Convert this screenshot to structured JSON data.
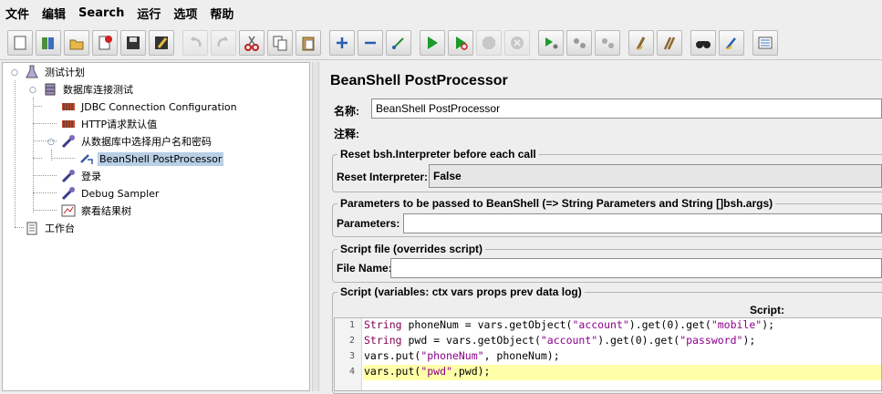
{
  "menu": {
    "items": [
      "文件",
      "编辑",
      "Search",
      "运行",
      "选项",
      "帮助"
    ]
  },
  "toolbar": {
    "buttons": [
      "new-icon",
      "templates-icon",
      "open-icon",
      "close-icon",
      "save-icon",
      "save-as-icon",
      "undo-icon",
      "redo-icon",
      "cut-icon",
      "copy-icon",
      "paste-icon",
      "expand-icon",
      "collapse-icon",
      "toggle-icon",
      "start-icon",
      "start-no-pause-icon",
      "stop-icon",
      "shutdown-icon",
      "remote-start-icon",
      "remote-stop-icon",
      "remote-shutdown-icon",
      "clear-icon",
      "clear-all-icon",
      "search-icon",
      "reset-search-icon",
      "function-helper-icon"
    ]
  },
  "tree": {
    "test_plan": "测试计划",
    "thread_group": "数据库连接测试",
    "jdbc_config": "JDBC Connection Configuration",
    "http_defaults": "HTTP请求默认值",
    "jdbc_sampler": "从数据库中选择用户名和密码",
    "beanshell": "BeanShell PostProcessor",
    "login": "登录",
    "debug_sampler": "Debug Sampler",
    "results_tree": "察看结果树",
    "workbench": "工作台"
  },
  "panel": {
    "title": "BeanShell PostProcessor",
    "name_label": "名称:",
    "name_value": "BeanShell PostProcessor",
    "comments_label": "注释:",
    "comments_value": "",
    "reset_group_title": "Reset bsh.Interpreter before each call",
    "reset_label": "Reset Interpreter:",
    "reset_value": "False",
    "params_group_title": "Parameters to be passed to BeanShell (=> String Parameters and String []bsh.args)",
    "params_label": "Parameters:",
    "params_value": "",
    "file_group_title": "Script file (overrides script)",
    "file_label": "File Name:",
    "file_value": "",
    "script_group_title": "Script (variables: ctx vars props prev data log)",
    "script_label": "Script:"
  },
  "script": {
    "line_numbers": [
      "1",
      "2",
      "3",
      "4"
    ],
    "lines": [
      "String phoneNum = vars.getObject(\"account\").get(0).get(\"mobile\");",
      "String pwd = vars.getObject(\"account\").get(0).get(\"password\");",
      "vars.put(\"phoneNum\", phoneNum);",
      "vars.put(\"pwd\",pwd);"
    ],
    "highlighted_line": 4
  }
}
